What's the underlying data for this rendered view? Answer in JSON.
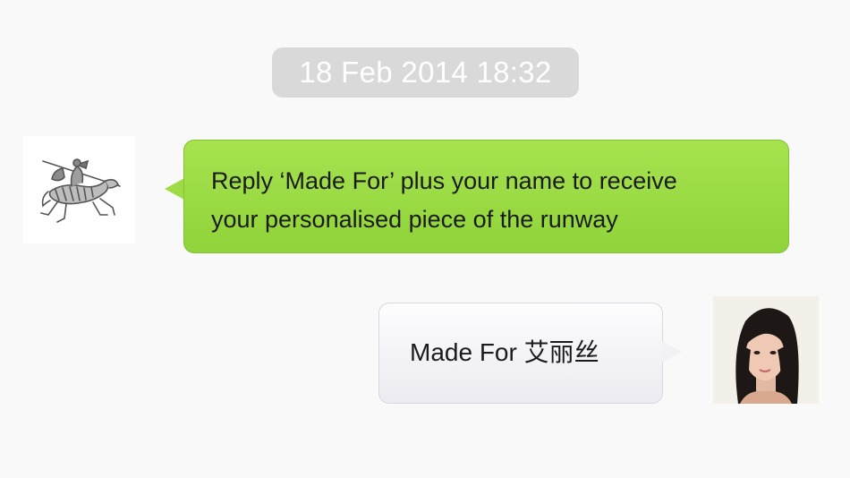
{
  "conversation": {
    "timestamp": "18 Feb 2014 18:32",
    "messages": [
      {
        "direction": "incoming",
        "sender_avatar": "knight-logo-icon",
        "lines": [
          "Reply ‘Made For’ plus your name to receive",
          "your personalised piece of the runway"
        ],
        "bubble_color": "#9ddc46"
      },
      {
        "direction": "outgoing",
        "sender_avatar": "user-photo",
        "lines": [
          "Made For 艾丽丝"
        ],
        "bubble_color": "#f2f2f6"
      }
    ]
  },
  "colors": {
    "background": "#f9f9f9",
    "timestamp_bg": "#d9d9d9",
    "timestamp_text": "#ffffff",
    "text": "#1b1b1b"
  }
}
